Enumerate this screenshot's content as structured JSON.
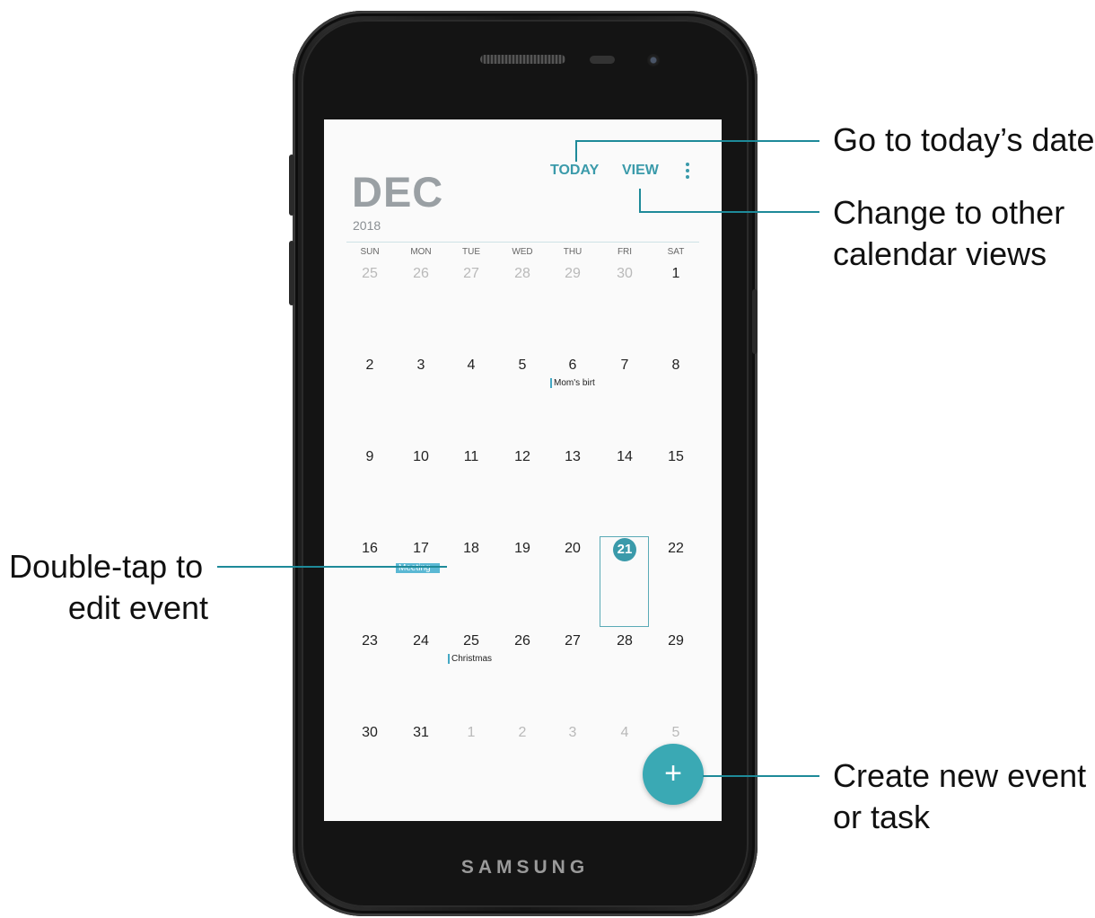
{
  "device": {
    "brand": "SAMSUNG"
  },
  "calendar": {
    "month": "DEC",
    "year": "2018",
    "today_label": "TODAY",
    "view_label": "VIEW",
    "weekdays": [
      "SUN",
      "MON",
      "TUE",
      "WED",
      "THU",
      "FRI",
      "SAT"
    ],
    "weeks": [
      [
        "25",
        "26",
        "27",
        "28",
        "29",
        "30",
        "1"
      ],
      [
        "2",
        "3",
        "4",
        "5",
        "6",
        "7",
        "8"
      ],
      [
        "9",
        "10",
        "11",
        "12",
        "13",
        "14",
        "15"
      ],
      [
        "16",
        "17",
        "18",
        "19",
        "20",
        "21",
        "22"
      ],
      [
        "23",
        "24",
        "25",
        "26",
        "27",
        "28",
        "29"
      ],
      [
        "30",
        "31",
        "1",
        "2",
        "3",
        "4",
        "5"
      ]
    ],
    "selected_day": "21",
    "events": {
      "moms_birthday": "Mom's birt",
      "meeting": "Meeting",
      "christmas": "Christmas"
    },
    "fab_symbol": "+"
  },
  "callouts": {
    "today": "Go to today’s date",
    "view_line1": "Change to other",
    "view_line2": "calendar views",
    "edit_line1": "Double-tap to",
    "edit_line2": "edit event",
    "create_line1": "Create new event",
    "create_line2": "or task"
  },
  "colors": {
    "accent": "#3a9aaa",
    "callout_line": "#1e8a99",
    "event": "#5ab8d4"
  }
}
